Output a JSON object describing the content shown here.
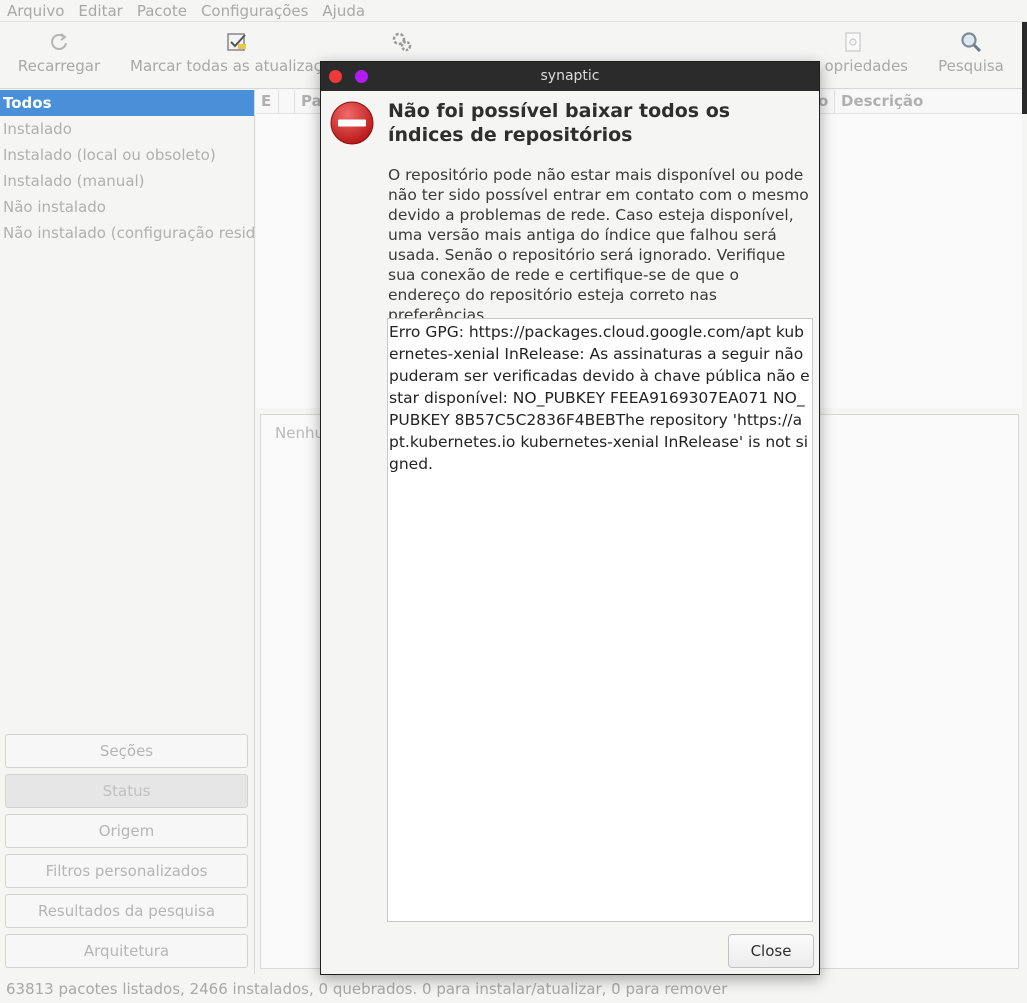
{
  "menubar": [
    "Arquivo",
    "Editar",
    "Pacote",
    "Configurações",
    "Ajuda"
  ],
  "toolbar": {
    "reload": "Recarregar",
    "mark_all": "Marcar todas as atualizaç",
    "properties": "opriedades",
    "search": "Pesquisa"
  },
  "filters": [
    "Todos",
    "Instalado",
    "Instalado (local ou obsoleto)",
    "Instalado (manual)",
    "Não instalado",
    "Não instalado (configuração residu"
  ],
  "filter_buttons": [
    "Seções",
    "Status",
    "Origem",
    "Filtros personalizados",
    "Resultados da pesquisa",
    "Arquitetura"
  ],
  "package_list": {
    "col_status": "E",
    "col_package": "Pa",
    "col_version_tail": "o",
    "col_description": "Descrição"
  },
  "description_pane": {
    "text": "Nenhu"
  },
  "statusbar": "63813 pacotes listados, 2466 instalados, 0 quebrados. 0 para instalar/atualizar, 0 para remover",
  "dialog": {
    "title": "synaptic",
    "heading": "Não foi possível baixar todos os índices de repositórios",
    "body": "O repositório pode não estar mais disponível ou pode não ter sido possível entrar em contato com o mesmo devido a problemas de rede. Caso esteja disponível, uma versão mais antiga do índice que falhou será usada. Senão o repositório será ignorado. Verifique sua conexão de rede e certifique-se de que o endereço do repositório esteja correto nas preferências.",
    "details": "Erro GPG: https://packages.cloud.google.com/apt kubernetes-xenial InRelease: As assinaturas a seguir não puderam ser verificadas devido à chave pública não estar disponível: NO_PUBKEY FEEA9169307EA071 NO_PUBKEY 8B57C5C2836F4BEBThe repository 'https://apt.kubernetes.io kubernetes-xenial InRelease' is not signed.",
    "close_button": "Close"
  },
  "colors": {
    "selection": "#4a90d9",
    "titlebar": "#2b2b2b",
    "close_dot": "#ef3a3a",
    "max_dot": "#b11cf0",
    "error_icon": "#d42a2a"
  }
}
